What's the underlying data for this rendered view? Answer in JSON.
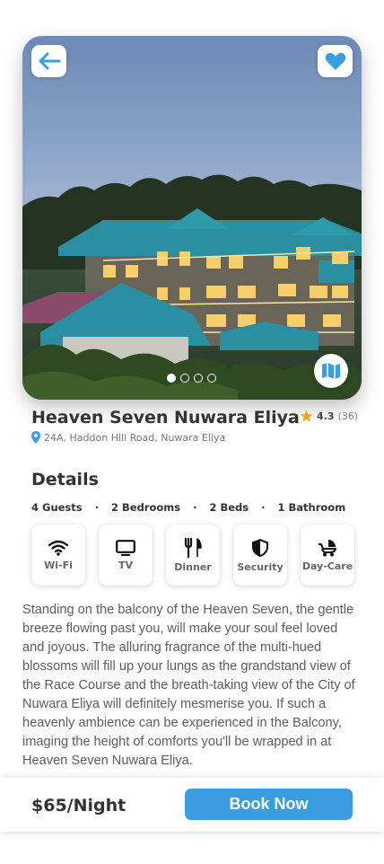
{
  "property": {
    "name": "Heaven Seven Nuwara Eliya",
    "address": "24A, Haddon Hill Road, Nuwara Eliya",
    "rating": "4.3",
    "reviews": "(36)"
  },
  "gallery": {
    "total_images": 4,
    "active_index": 0
  },
  "details": {
    "heading": "Details",
    "specs": [
      "4 Guests",
      "2 Bedrooms",
      "2 Beds",
      "1 Bathroom"
    ],
    "separator": "·"
  },
  "amenities": [
    {
      "label": "Wi-Fi",
      "icon": "wifi-icon"
    },
    {
      "label": "TV",
      "icon": "tv-icon"
    },
    {
      "label": "Dinner",
      "icon": "dinner-icon"
    },
    {
      "label": "Security",
      "icon": "shield-icon"
    },
    {
      "label": "Day-Care",
      "icon": "stroller-icon"
    }
  ],
  "description": "Standing on the balcony of the Heaven Seven, the gentle breeze flowing past you, will make your soul feel loved and joyous. The alluring fragrance of the multi-hued blossoms will fill up your lungs as the grandstand view of the Race Course and the breath-taking view of the City of Nuwara Eliya will definitely mesmerise you. If such a heavenly ambience can be experienced in the Balcony, imaging the height of comforts you'll be wrapped in at Heaven Seven Nuwara Eliya.",
  "booking": {
    "price": "$65/Night",
    "button_label": "Book Now"
  },
  "colors": {
    "accent": "#3a9de0",
    "star": "#f5a623"
  }
}
